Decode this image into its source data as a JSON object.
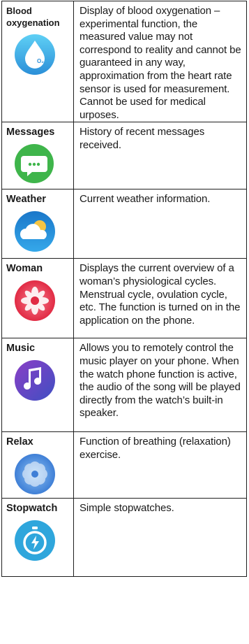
{
  "rows": [
    {
      "name": "Blood oxygenation",
      "icon": "blood-oxygen-drop-icon",
      "description": "Display of blood oxygenation – experimental function, the measured value may not correspond to reality and cannot be guaranteed in any way, approximation from the heart rate sensor is used for measurement. Cannot be used for medical urposes.",
      "icon_badge": "O₂",
      "color": "#3ab0e6"
    },
    {
      "name": "Messages",
      "icon": "message-bubble-icon",
      "description": "History of recent messages received.",
      "color": "#3fb54b"
    },
    {
      "name": "Weather",
      "icon": "weather-cloud-sun-icon",
      "description": "Current weather information.",
      "color": "#1e8fd6"
    },
    {
      "name": "Woman",
      "icon": "woman-flower-icon",
      "description": "Displays the current overview of a woman’s physiological cycles. Menstrual cycle, ovulation cycle, etc. The function is turned on in the application on the phone.",
      "color": "#e8334d"
    },
    {
      "name": "Music",
      "icon": "music-note-icon",
      "description": "Allows you to remotely control the music player on your phone. When the watch phone function is active, the audio of the song will be played directly from the watch’s built-in speaker.",
      "color": "#5b3fbf"
    },
    {
      "name": "Relax",
      "icon": "relax-breathing-icon",
      "description": "Function of breathing (relaxation) exercise.",
      "color": "#4f8fdc"
    },
    {
      "name": "Stopwatch",
      "icon": "stopwatch-icon",
      "description": "Simple stopwatches.",
      "color": "#2fa6dc"
    }
  ]
}
